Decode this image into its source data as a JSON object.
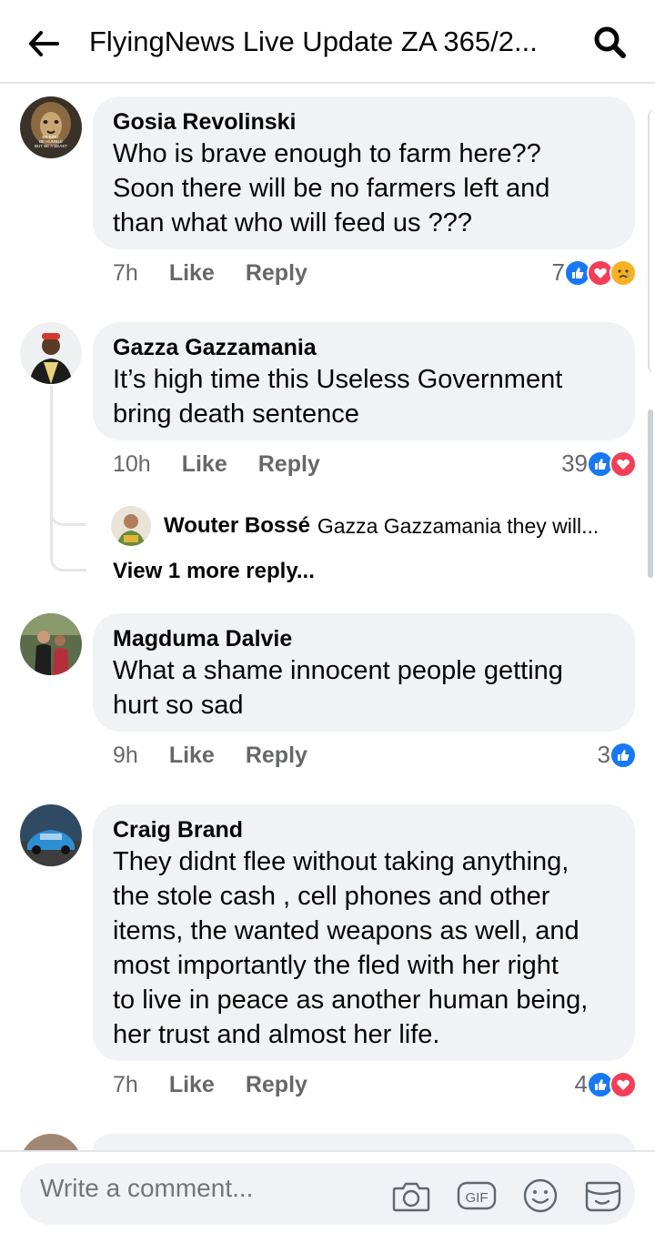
{
  "header": {
    "title": "FlyingNews Live Update ZA 365/2..."
  },
  "comments": [
    {
      "author": "Gosia Revolinski",
      "text": "Who is brave enough to farm here??\nSoon there will be no farmers  left and\nthan what who will feed us ???",
      "time": "7h",
      "like": "Like",
      "reply": "Reply",
      "reaction_count": "7",
      "reactions": [
        "like",
        "love",
        "sad"
      ],
      "avatar_text": "BE KIND. BE HUMBLE BUT BE A BEAST"
    },
    {
      "author": "Gazza Gazzamania",
      "text": "It’s high time this Useless Government\nbring death sentence",
      "time": "10h",
      "like": "Like",
      "reply": "Reply",
      "reaction_count": "39",
      "reactions": [
        "like",
        "love"
      ]
    },
    {
      "author": "Magduma Dalvie",
      "text": "What a shame innocent people getting\nhurt so sad",
      "time": "9h",
      "like": "Like",
      "reply": "Reply",
      "reaction_count": "3",
      "reactions": [
        "like"
      ]
    },
    {
      "author": "Craig Brand",
      "text": "They didnt flee without taking anything,\nthe stole cash , cell phones and other\nitems, the wanted weapons as well, and\nmost importantly the fled with her right\nto live in peace as another human being,\nher trust and almost her life.",
      "time": "7h",
      "like": "Like",
      "reply": "Reply",
      "reaction_count": "4",
      "reactions": [
        "like",
        "love"
      ]
    }
  ],
  "reply_preview": {
    "author": "Wouter Bossé",
    "text": "Gazza Gazzamania they will...",
    "view_more": "View 1 more reply..."
  },
  "composer": {
    "placeholder": "Write a comment..."
  },
  "colors": {
    "like": "#1877f2",
    "love": "#f33e58",
    "sad": "#f7b125",
    "bubble": "#f0f2f5"
  }
}
